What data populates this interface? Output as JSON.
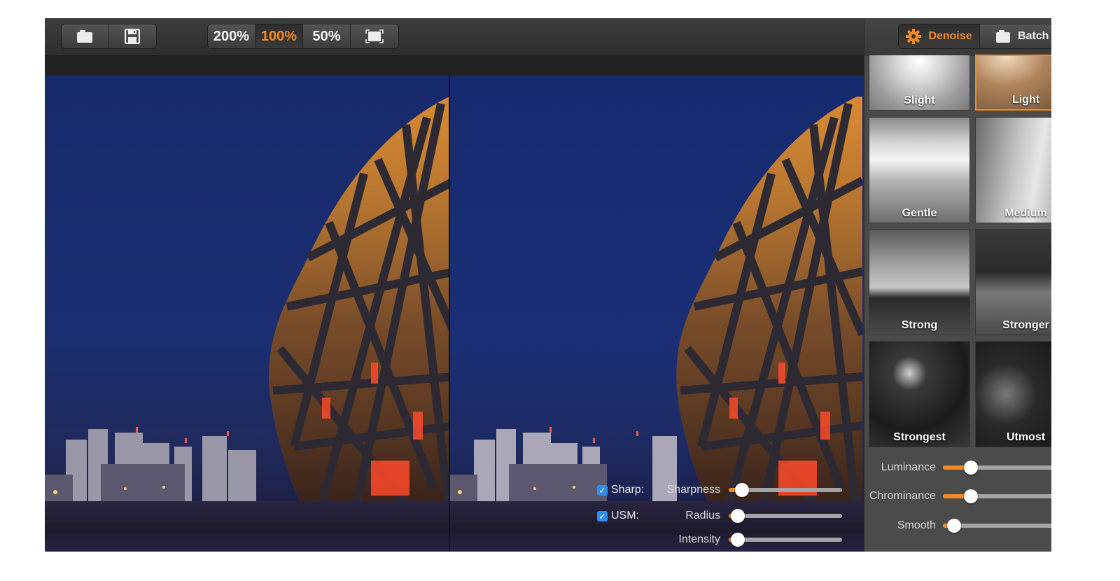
{
  "toolbar": {
    "file_buttons": [
      {
        "icon": "folder-icon",
        "label": ""
      },
      {
        "icon": "save-icon",
        "label": ""
      }
    ],
    "zoom_buttons": [
      {
        "label": "200%",
        "active": false
      },
      {
        "label": "100%",
        "active": true
      },
      {
        "label": "50%",
        "active": false
      },
      {
        "icon": "fit-screen-icon",
        "label": ""
      }
    ]
  },
  "colors": {
    "accent": "#f08a24",
    "checkbox": "#2b8ef3",
    "panel_bg": "#4b4b4b",
    "toolbar_bg": "#333333"
  },
  "mode_tabs": [
    {
      "label": "Denoise",
      "icon": "gear-icon",
      "active": true
    },
    {
      "label": "Batch",
      "icon": "folder-icon",
      "active": false
    }
  ],
  "presets": [
    {
      "label": "Slight",
      "selected": false
    },
    {
      "label": "Light",
      "selected": true
    },
    {
      "label": "Gentle",
      "selected": false
    },
    {
      "label": "Medium",
      "selected": false
    },
    {
      "label": "Strong",
      "selected": false
    },
    {
      "label": "Stronger",
      "selected": false
    },
    {
      "label": "Strongest",
      "selected": false
    },
    {
      "label": "Utmost",
      "selected": false
    }
  ],
  "levels": [
    {
      "label": "Luminance",
      "value": 0.25
    },
    {
      "label": "Chrominance",
      "value": 0.25
    },
    {
      "label": "Smooth",
      "value": 0.1
    }
  ],
  "sharpen": {
    "sharp": {
      "label": "Sharp:",
      "checked": true,
      "param": "Sharpness",
      "value": 0.12
    },
    "usm": {
      "label": "USM:",
      "checked": true,
      "param_radius": "Radius",
      "radius": 0.08,
      "param_intensity": "Intensity",
      "intensity": 0.08
    },
    "check_glyph": "✓"
  }
}
